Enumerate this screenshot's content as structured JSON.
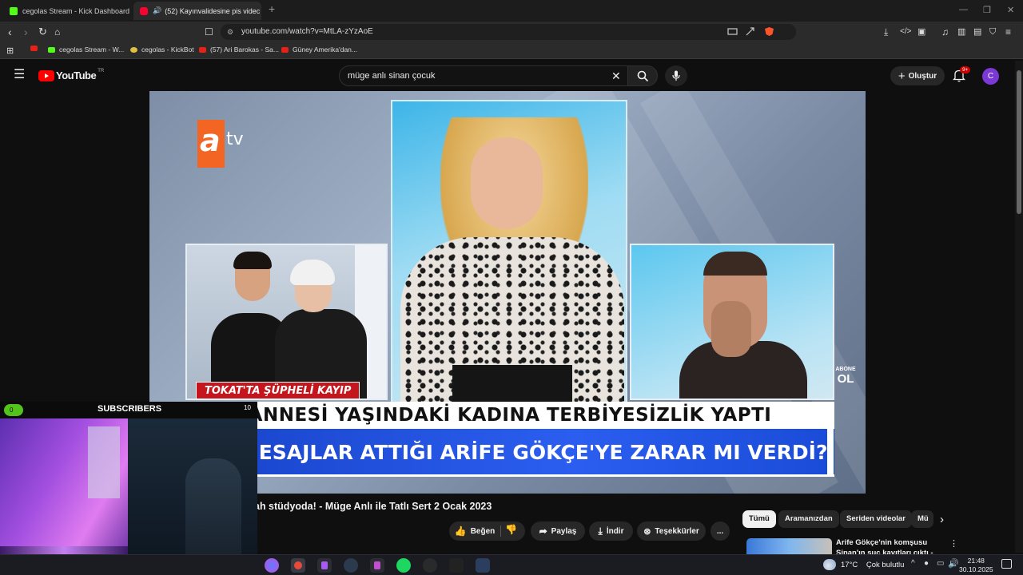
{
  "browser": {
    "tabs": [
      {
        "title": "cegolas Stream - Kick Dashboard",
        "active": false,
        "favicon_color": "#53fc18"
      },
      {
        "title": "(52) Kayınvalidesine pis videc",
        "active": true,
        "favicon_color": "#ff0033"
      }
    ],
    "url": "youtube.com/watch?v=MtLA-zYzAoE",
    "bookmarks": [
      {
        "label": ""
      },
      {
        "label": "cegolas Stream - W..."
      },
      {
        "label": "cegolas - KickBot"
      },
      {
        "label": "(57) Ari Barokas - Sa..."
      },
      {
        "label": "Güney Amerika'dan..."
      }
    ],
    "extension_badge": "1"
  },
  "youtube": {
    "logo_text": "YouTube",
    "country_code": "TR",
    "search_query": "müge anlı sinan çocuk",
    "create_label": "Oluştur",
    "notification_count": "9+",
    "avatar_letter": "C",
    "accent": "#ff0000"
  },
  "video": {
    "channel_logo_a": "a",
    "channel_logo_tv": "tv",
    "location_tag": "TOKAT'TA ŞÜPHELİ KAYIP",
    "headline_top": "ANNESİ YAŞINDAKİ KADINA TERBİYESİZLİK YAPTI",
    "headline_bottom": "KİN MESAJLAR ATTIĞI ARİFE GÖKÇE'YE ZARAR MI VERDİ?",
    "subscribe_small": "ABONE",
    "subscribe_big": "OL",
    "title": "ah stüdyoda! - Müge Anlı ile Tatlı Sert 2 Ocak 2023"
  },
  "actions": {
    "like": "Beğen",
    "share": "Paylaş",
    "download": "İndir",
    "thanks": "Teşekkürler",
    "more": "..."
  },
  "chips": [
    "Tümü",
    "Aramanızdan",
    "Seriden videolar",
    "Mü"
  ],
  "sidebar_video": {
    "title": "Arife Gökçe'nin komşusu Sinan'ın suç kayıtları çıktı -"
  },
  "overlay": {
    "sub_count": "0",
    "label": "SUBSCRIBERS",
    "goal": "10"
  },
  "taskbar": {
    "temperature": "17°C",
    "weather": "Çok bulutlu",
    "time": "21:48",
    "date": "30.10.2025"
  }
}
